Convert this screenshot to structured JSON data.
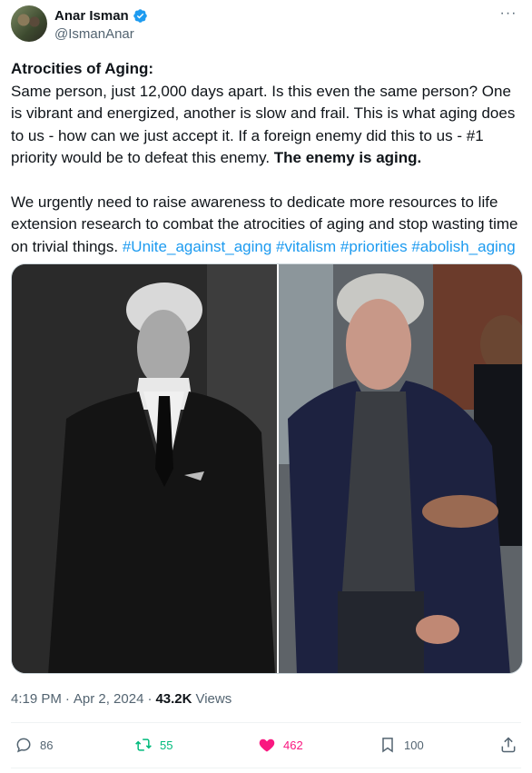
{
  "author": {
    "display_name": "Anar Isman",
    "handle": "@IsmanAnar",
    "verified": true
  },
  "tweet": {
    "title": "Atrocities of Aging:",
    "body_1": "Same person, just 12,000 days apart. Is this even the same person? One is vibrant and energized, another is slow and frail. This is what aging does to us - how can we just accept it. If a foreign enemy did this to us - #1 priority would be to defeat this enemy. ",
    "body_1_bold": "The enemy is aging.",
    "body_2": "We urgently need to raise awareness to dedicate more resources to life extension research to combat the atrocities of aging and stop wasting time on trivial things. ",
    "hashtags": [
      "#Unite_against_aging",
      "#vitalism",
      "#priorities",
      "#abolish_aging"
    ]
  },
  "meta": {
    "time": "4:19 PM",
    "separator": "·",
    "date": "Apr 2, 2024",
    "views_count": "43.2K",
    "views_label": "Views"
  },
  "actions": {
    "replies": "86",
    "reposts": "55",
    "likes": "462",
    "bookmarks": "100"
  },
  "colors": {
    "text": "#0f1419",
    "secondary": "#536471",
    "link": "#1d9bf0",
    "repost": "#00ba7c",
    "like": "#f91880"
  }
}
